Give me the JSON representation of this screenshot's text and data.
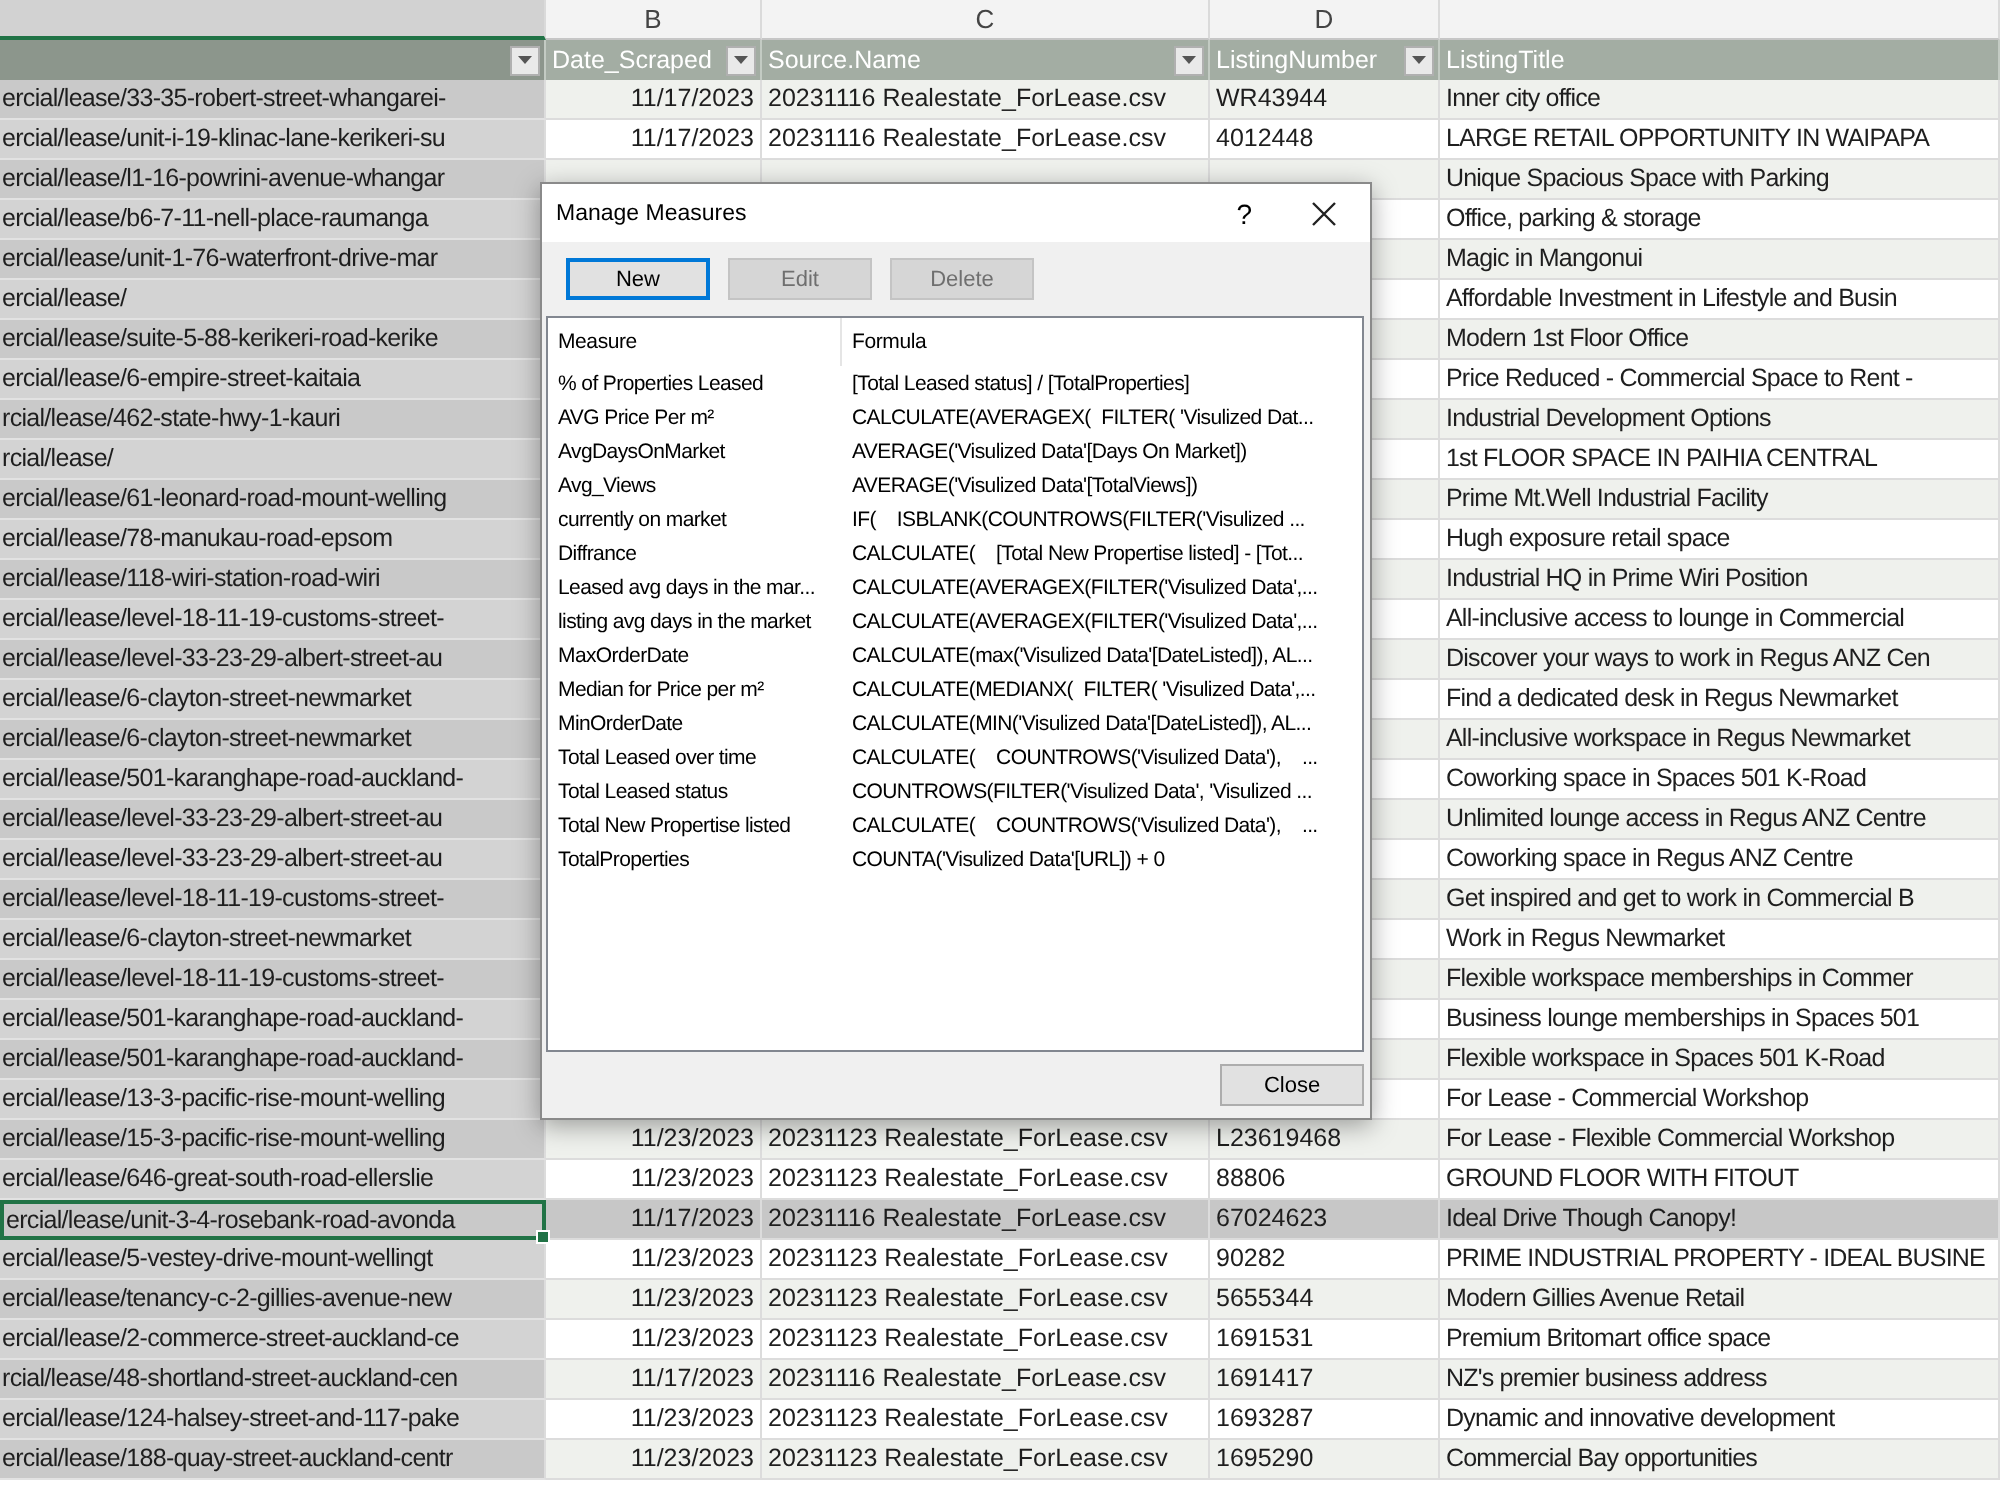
{
  "sheet": {
    "columns": [
      {
        "selected": true,
        "filter": true
      },
      {
        "letter": "B",
        "label": "Date_Scraped",
        "selected": false,
        "filter": true
      },
      {
        "letter": "C",
        "label": "Source.Name",
        "selected": false,
        "filter": true
      },
      {
        "letter": "D",
        "label": "ListingNumber",
        "selected": false,
        "filter": true
      },
      {
        "label": "ListingTitle",
        "selected": false,
        "filter": false
      }
    ],
    "rows": [
      {
        "column_1": "ercial/lease/33-35-robert-street-whangarei-",
        "date_scraped": "11/17/2023",
        "source_name": "20231116 Realestate_ForLease.csv",
        "listing_number": "WR43944",
        "listing_title": "Inner city office",
        "selected": false
      },
      {
        "column_1": "ercial/lease/unit-i-19-klinac-lane-kerikeri-su",
        "date_scraped": "11/17/2023",
        "source_name": "20231116 Realestate_ForLease.csv",
        "listing_number": "4012448",
        "listing_title": "LARGE RETAIL OPPORTUNITY IN WAIPAPA",
        "selected": false
      },
      {
        "column_1": "ercial/lease/l1-16-powrini-avenue-whangar",
        "listing_title": "Unique Spacious Space with Parking",
        "selected": false
      },
      {
        "column_1": "ercial/lease/b6-7-11-nell-place-raumanga",
        "listing_title": "Office, parking & storage",
        "selected": false
      },
      {
        "column_1": "ercial/lease/unit-1-76-waterfront-drive-mar",
        "listing_title": "Magic in Mangonui",
        "selected": false
      },
      {
        "column_1": "ercial/lease/",
        "listing_title": "Affordable Investment in Lifestyle and Busin",
        "selected": false
      },
      {
        "column_1": "ercial/lease/suite-5-88-kerikeri-road-kerike",
        "listing_title": "Modern 1st Floor Office",
        "selected": false
      },
      {
        "column_1": "ercial/lease/6-empire-street-kaitaia",
        "listing_title": "Price Reduced - Commercial Space to Rent -",
        "selected": false
      },
      {
        "column_1": "rcial/lease/462-state-hwy-1-kauri",
        "listing_title": "Industrial Development Options",
        "selected": false
      },
      {
        "column_1": "rcial/lease/",
        "listing_title": "1st FLOOR SPACE IN PAIHIA CENTRAL",
        "selected": false
      },
      {
        "column_1": "ercial/lease/61-leonard-road-mount-welling",
        "listing_title": "Prime Mt.Well Industrial Facility",
        "selected": false
      },
      {
        "column_1": "ercial/lease/78-manukau-road-epsom",
        "listing_title": "Hugh exposure retail space",
        "selected": false
      },
      {
        "column_1": "ercial/lease/118-wiri-station-road-wiri",
        "listing_title": "Industrial HQ in Prime Wiri Position",
        "selected": false
      },
      {
        "column_1": "ercial/lease/level-18-11-19-customs-street-",
        "listing_title": "All-inclusive access to lounge in Commercial",
        "selected": false
      },
      {
        "column_1": "ercial/lease/level-33-23-29-albert-street-au",
        "listing_title": "Discover your ways to work in Regus ANZ Cen",
        "selected": false
      },
      {
        "column_1": "ercial/lease/6-clayton-street-newmarket",
        "listing_title": "Find a dedicated desk in Regus Newmarket",
        "selected": false
      },
      {
        "column_1": "ercial/lease/6-clayton-street-newmarket",
        "listing_title": "All-inclusive workspace in Regus Newmarket",
        "selected": false
      },
      {
        "column_1": "ercial/lease/501-karanghape-road-auckland-",
        "listing_title": "Coworking space in Spaces 501 K-Road",
        "selected": false
      },
      {
        "column_1": "ercial/lease/level-33-23-29-albert-street-au",
        "listing_title": "Unlimited lounge access in Regus ANZ Centre",
        "selected": false
      },
      {
        "column_1": "ercial/lease/level-33-23-29-albert-street-au",
        "listing_title": "Coworking space in Regus ANZ Centre",
        "selected": false
      },
      {
        "column_1": "ercial/lease/level-18-11-19-customs-street-",
        "listing_title": "Get inspired and get to work in Commercial B",
        "selected": false
      },
      {
        "column_1": "ercial/lease/6-clayton-street-newmarket",
        "listing_title": "Work in Regus Newmarket",
        "selected": false
      },
      {
        "column_1": "ercial/lease/level-18-11-19-customs-street-",
        "listing_title": "Flexible workspace memberships in Commer",
        "selected": false
      },
      {
        "column_1": "ercial/lease/501-karanghape-road-auckland-",
        "listing_title": "Business lounge memberships in Spaces 501",
        "selected": false
      },
      {
        "column_1": "ercial/lease/501-karanghape-road-auckland-",
        "listing_title": "Flexible workspace in Spaces 501 K-Road",
        "selected": false
      },
      {
        "column_1": "ercial/lease/13-3-pacific-rise-mount-welling",
        "listing_title": "For Lease - Commercial Workshop",
        "selected": false
      },
      {
        "column_1": "ercial/lease/15-3-pacific-rise-mount-welling",
        "date_scraped": "11/23/2023",
        "source_name": "20231123 Realestate_ForLease.csv",
        "listing_number": "L23619468",
        "listing_title": "For Lease - Flexible Commercial Workshop",
        "selected": false
      },
      {
        "column_1": "ercial/lease/646-great-south-road-ellerslie",
        "date_scraped": "11/23/2023",
        "source_name": "20231123 Realestate_ForLease.csv",
        "listing_number": "88806",
        "listing_title": "GROUND FLOOR WITH FITOUT",
        "selected": false
      },
      {
        "column_1": "ercial/lease/unit-3-4-rosebank-road-avonda",
        "date_scraped": "11/17/2023",
        "source_name": "20231116 Realestate_ForLease.csv",
        "listing_number": "67024623",
        "listing_title": "Ideal Drive Though Canopy!",
        "selected": true
      },
      {
        "column_1": "ercial/lease/5-vestey-drive-mount-wellingt",
        "date_scraped": "11/23/2023",
        "source_name": "20231123 Realestate_ForLease.csv",
        "listing_number": "90282",
        "listing_title": "PRIME INDUSTRIAL PROPERTY - IDEAL BUSINE",
        "selected": false
      },
      {
        "column_1": "ercial/lease/tenancy-c-2-gillies-avenue-new",
        "date_scraped": "11/23/2023",
        "source_name": "20231123 Realestate_ForLease.csv",
        "listing_number": "5655344",
        "listing_title": "Modern Gillies Avenue Retail",
        "selected": false
      },
      {
        "column_1": "ercial/lease/2-commerce-street-auckland-ce",
        "date_scraped": "11/23/2023",
        "source_name": "20231123 Realestate_ForLease.csv",
        "listing_number": "1691531",
        "listing_title": "Premium Britomart office space",
        "selected": false
      },
      {
        "column_1": "rcial/lease/48-shortland-street-auckland-cen",
        "date_scraped": "11/17/2023",
        "source_name": "20231116 Realestate_ForLease.csv",
        "listing_number": "1691417",
        "listing_title": "NZ's premier business address",
        "selected": false
      },
      {
        "column_1": "ercial/lease/124-halsey-street-and-117-pake",
        "date_scraped": "11/23/2023",
        "source_name": "20231123 Realestate_ForLease.csv",
        "listing_number": "1693287",
        "listing_title": "Dynamic and innovative development",
        "selected": false
      },
      {
        "column_1": "ercial/lease/188-quay-street-auckland-centr",
        "date_scraped": "11/23/2023",
        "source_name": "20231123 Realestate_ForLease.csv",
        "listing_number": "1695290",
        "listing_title": "Commercial Bay opportunities",
        "selected": false
      }
    ]
  },
  "dialog": {
    "title": "Manage Measures",
    "help": "?",
    "buttons": [
      {
        "label": "New",
        "disabled": false,
        "focused": true
      },
      {
        "label": "Edit",
        "disabled": true,
        "focused": false
      },
      {
        "label": "Delete",
        "disabled": true,
        "focused": false
      }
    ],
    "list": {
      "columns": [
        "Measure",
        "Formula"
      ],
      "items": [
        {
          "measure": "% of Properties Leased",
          "formula": "[Total Leased status] / [TotalProperties]",
          "selected": false
        },
        {
          "measure": "AVG Price Per m²",
          "formula": "CALCULATE(AVERAGEX(  FILTER( 'Visulized Dat...",
          "selected": false
        },
        {
          "measure": "AvgDaysOnMarket",
          "formula": "AVERAGE('Visulized Data'[Days On Market])",
          "selected": false
        },
        {
          "measure": "Avg_Views",
          "formula": "AVERAGE('Visulized Data'[TotalViews])",
          "selected": false
        },
        {
          "measure": "currently on market",
          "formula": "IF(    ISBLANK(COUNTROWS(FILTER('Visulized ...",
          "selected": false
        },
        {
          "measure": "Diffrance",
          "formula": "CALCULATE(    [Total New Propertise listed] - [Tot...",
          "selected": false
        },
        {
          "measure": "Leased avg days in the mar...",
          "formula": "CALCULATE(AVERAGEX(FILTER('Visulized Data',...",
          "selected": false
        },
        {
          "measure": "listing avg days in the market",
          "formula": "CALCULATE(AVERAGEX(FILTER('Visulized Data',...",
          "selected": false
        },
        {
          "measure": "MaxOrderDate",
          "formula": "CALCULATE(max('Visulized Data'[DateListed]), AL...",
          "selected": false
        },
        {
          "measure": "Median for Price per m²",
          "formula": "CALCULATE(MEDIANX(  FILTER( 'Visulized Data',...",
          "selected": false
        },
        {
          "measure": "MinOrderDate",
          "formula": "CALCULATE(MIN('Visulized Data'[DateListed]), AL...",
          "selected": false
        },
        {
          "measure": "Total Leased over time",
          "formula": "CALCULATE(    COUNTROWS('Visulized Data'),    ...",
          "selected": false
        },
        {
          "measure": "Total Leased status",
          "formula": "COUNTROWS(FILTER('Visulized Data', 'Visulized ...",
          "selected": false
        },
        {
          "measure": "Total New Propertise listed",
          "formula": "CALCULATE(    COUNTROWS('Visulized Data'),    ...",
          "selected": false
        },
        {
          "measure": "TotalProperties",
          "formula": "COUNTA('Visulized Data'[URL]) + 0",
          "selected": false
        }
      ]
    },
    "close_button": "Close"
  }
}
